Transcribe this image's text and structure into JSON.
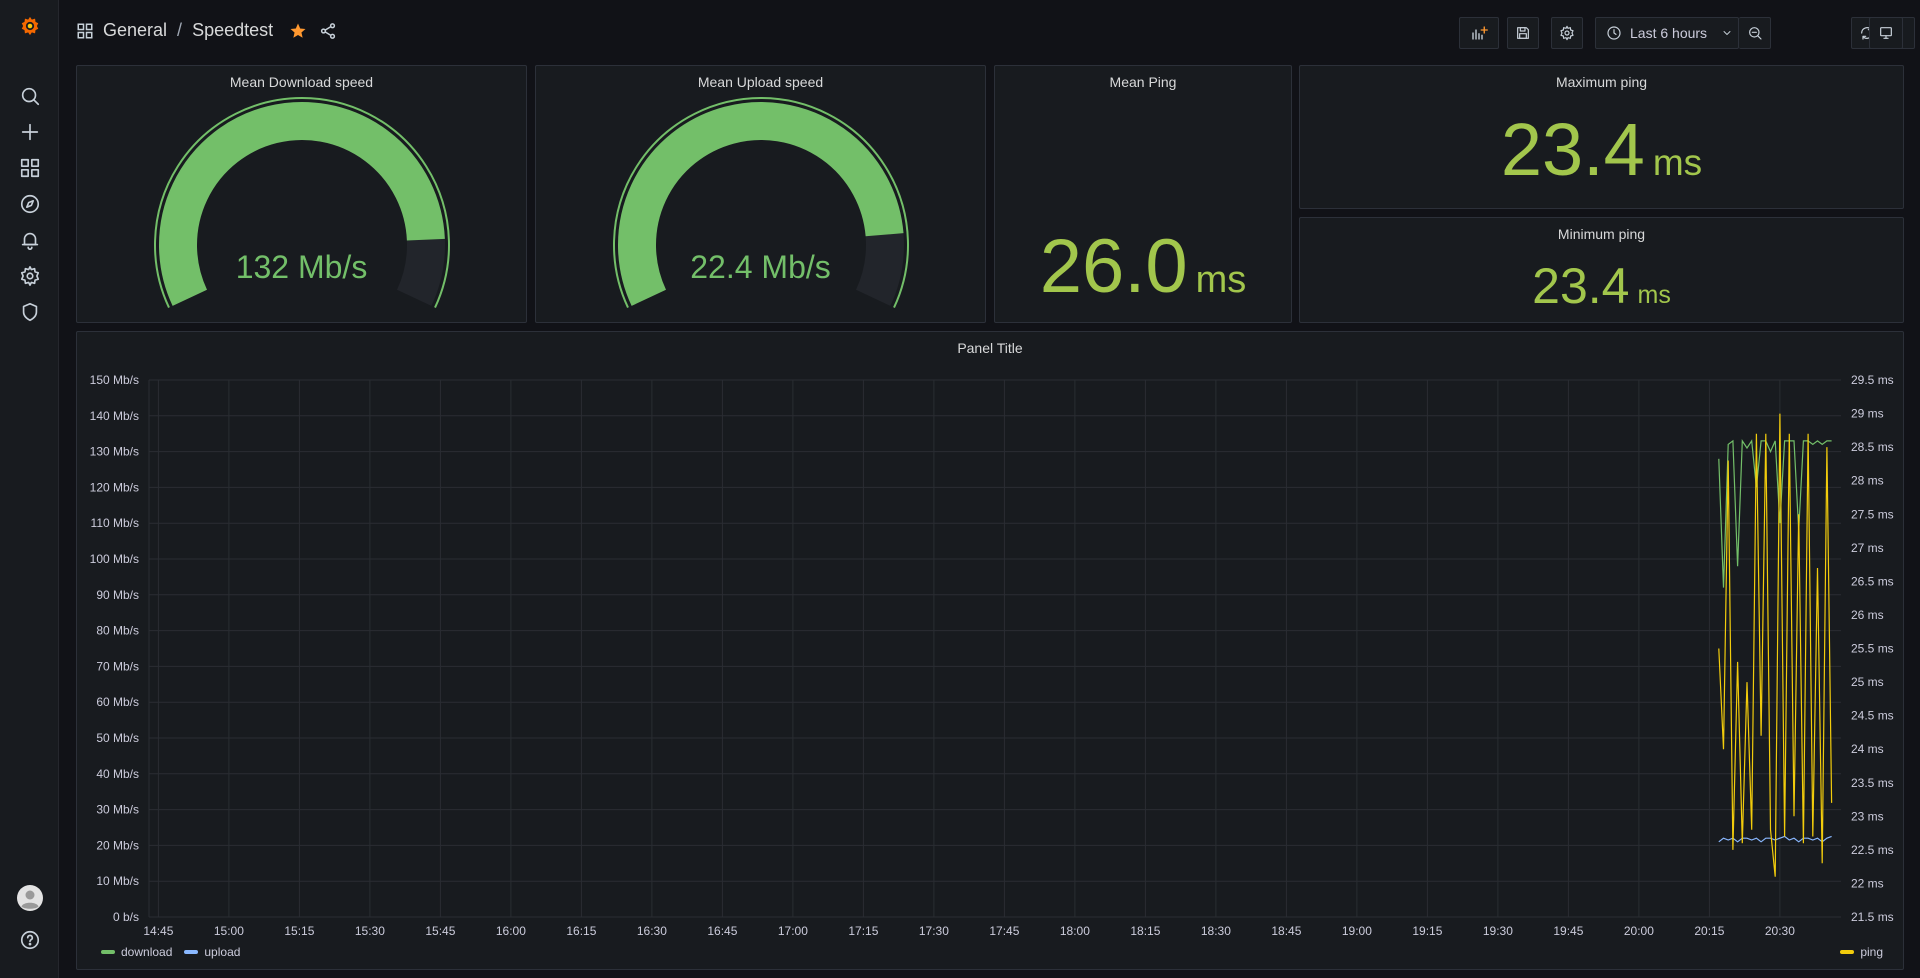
{
  "breadcrumb": {
    "folder": "General",
    "separator": "/",
    "dashboard": "Speedtest"
  },
  "toolbar": {
    "time_range": "Last 6 hours"
  },
  "icons": {
    "logo": "grafana-logo",
    "search": "search-icon",
    "create": "plus-icon",
    "dashboards": "apps-icon",
    "explore": "compass-icon",
    "alerting": "bell-icon",
    "config": "gear-icon",
    "admin": "shield-icon",
    "help": "question-icon",
    "star": "star-icon",
    "share": "share-icon"
  },
  "colors": {
    "gauge_green": "#73bf69",
    "stat_green": "#a2c64c",
    "download": "#73bf69",
    "upload": "#8ab8ff",
    "ping": "#f2cc0c",
    "star": "#ff9830"
  },
  "panels": {
    "download": {
      "title": "Mean Download speed",
      "value": "132 Mb/s",
      "fraction": 0.88
    },
    "upload": {
      "title": "Mean Upload speed",
      "value": "22.4 Mb/s",
      "fraction": 0.87
    },
    "ping": {
      "title": "Mean Ping",
      "value": "26.0",
      "unit": "ms"
    },
    "max_ping": {
      "title": "Maximum ping",
      "value": "23.4",
      "unit": "ms"
    },
    "min_ping": {
      "title": "Minimum ping",
      "value": "23.4",
      "unit": "ms"
    },
    "graph": {
      "title": "Panel Title"
    }
  },
  "chart_data": {
    "type": "line",
    "title": "Panel Title",
    "x_ticks": [
      "14:45",
      "15:00",
      "15:15",
      "15:30",
      "15:45",
      "16:00",
      "16:15",
      "16:30",
      "16:45",
      "17:00",
      "17:15",
      "17:30",
      "17:45",
      "18:00",
      "18:15",
      "18:30",
      "18:45",
      "19:00",
      "19:15",
      "19:30",
      "19:45",
      "20:00",
      "20:15",
      "20:30"
    ],
    "xlim": [
      "14:43",
      "20:43"
    ],
    "y_left_ticks": [
      "150 Mb/s",
      "140 Mb/s",
      "130 Mb/s",
      "120 Mb/s",
      "110 Mb/s",
      "100 Mb/s",
      "90 Mb/s",
      "80 Mb/s",
      "70 Mb/s",
      "60 Mb/s",
      "50 Mb/s",
      "40 Mb/s",
      "30 Mb/s",
      "20 Mb/s",
      "10 Mb/s",
      "0 b/s"
    ],
    "y_left_lim": [
      0,
      150
    ],
    "y_right_ticks": [
      "29.5 ms",
      "29 ms",
      "28.5 ms",
      "28 ms",
      "27.5 ms",
      "27 ms",
      "26.5 ms",
      "26 ms",
      "25.5 ms",
      "25 ms",
      "24.5 ms",
      "24 ms",
      "23.5 ms",
      "23 ms",
      "22.5 ms",
      "22 ms",
      "21.5 ms"
    ],
    "y_right_lim": [
      21.5,
      29.5
    ],
    "grid": true,
    "legend_position": "bottom",
    "series": [
      {
        "name": "download",
        "axis": "left",
        "x": [
          "20:17",
          "20:18",
          "20:19",
          "20:20",
          "20:21",
          "20:22",
          "20:23",
          "20:24",
          "20:25",
          "20:26",
          "20:27",
          "20:28",
          "20:29",
          "20:30",
          "20:31",
          "20:32",
          "20:33",
          "20:34",
          "20:35",
          "20:36",
          "20:37",
          "20:38",
          "20:39",
          "20:40",
          "20:41"
        ],
        "values": [
          128,
          92,
          132,
          133,
          98,
          133,
          131,
          133,
          120,
          133,
          133,
          130,
          133,
          110,
          133,
          133,
          133,
          108,
          133,
          133,
          132,
          133,
          132,
          133,
          133
        ]
      },
      {
        "name": "upload",
        "axis": "left",
        "x": [
          "20:17",
          "20:18",
          "20:19",
          "20:20",
          "20:21",
          "20:22",
          "20:23",
          "20:24",
          "20:25",
          "20:26",
          "20:27",
          "20:28",
          "20:29",
          "20:30",
          "20:31",
          "20:32",
          "20:33",
          "20:34",
          "20:35",
          "20:36",
          "20:37",
          "20:38",
          "20:39",
          "20:40",
          "20:41"
        ],
        "values": [
          21,
          22,
          21.5,
          22,
          21,
          22,
          22,
          21.5,
          22,
          21,
          22,
          22,
          21.5,
          22,
          22.5,
          21.5,
          22,
          21,
          22,
          22,
          21.5,
          22,
          21,
          22,
          22.5
        ]
      },
      {
        "name": "ping",
        "axis": "right",
        "x": [
          "20:17",
          "20:18",
          "20:19",
          "20:20",
          "20:21",
          "20:22",
          "20:23",
          "20:24",
          "20:25",
          "20:26",
          "20:27",
          "20:28",
          "20:29",
          "20:30",
          "20:31",
          "20:32",
          "20:33",
          "20:34",
          "20:35",
          "20:36",
          "20:37",
          "20:38",
          "20:39",
          "20:40",
          "20:41"
        ],
        "values": [
          25.5,
          24,
          28.3,
          22.5,
          25.3,
          22.6,
          25.0,
          22.8,
          28.7,
          24.2,
          28.7,
          22.8,
          22.1,
          29.0,
          22.7,
          28.7,
          23.0,
          27.5,
          22.6,
          28.7,
          22.7,
          26.7,
          22.3,
          28.5,
          23.2
        ]
      }
    ]
  },
  "legend": {
    "download": "download",
    "upload": "upload",
    "ping": "ping"
  }
}
